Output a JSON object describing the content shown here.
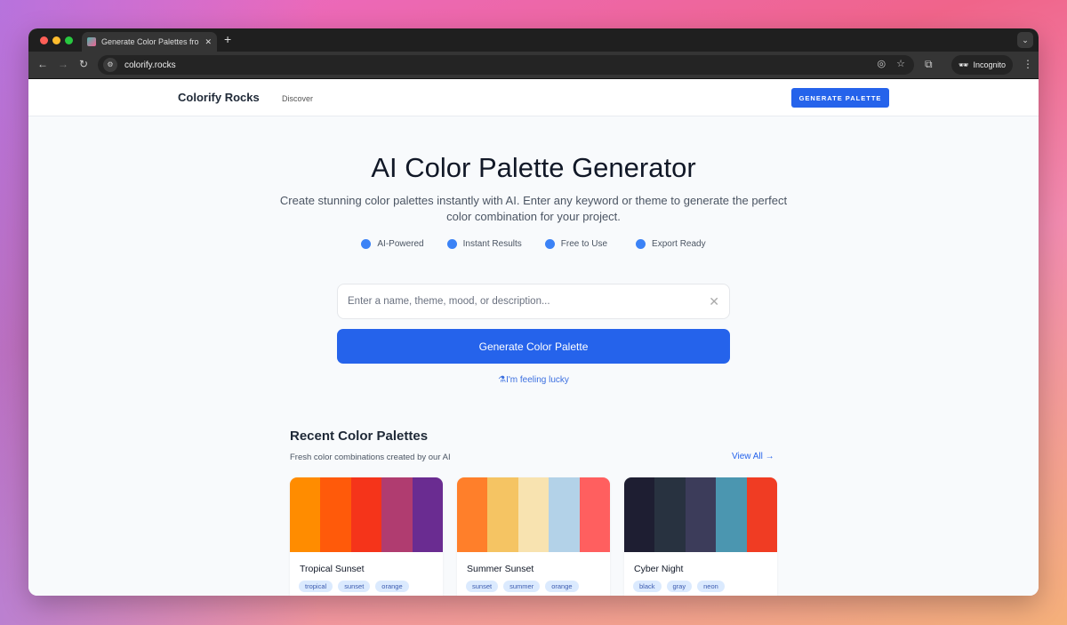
{
  "browser": {
    "tab_title": "Generate Color Palettes from",
    "url": "colorify.rocks",
    "incognito_label": "Incognito"
  },
  "header": {
    "logo": "Colorify Rocks",
    "nav": [
      "Discover"
    ],
    "cta": "GENERATE PALETTE"
  },
  "hero": {
    "title": "AI Color Palette Generator",
    "subtitle": "Create stunning color palettes instantly with AI. Enter any keyword or theme to generate the perfect color combination for your project.",
    "features": [
      "AI-Powered",
      "Instant Results",
      "Free to Use",
      "Export Ready"
    ],
    "feature_dot_color": "#3b82f6"
  },
  "search": {
    "placeholder": "Enter a name, theme, mood, or description...",
    "value": "",
    "button": "Generate Color Palette",
    "lucky": "I'm feeling lucky"
  },
  "recent": {
    "title": "Recent Color Palettes",
    "subtitle": "Fresh color combinations created by our AI",
    "view_all": "View All →",
    "palettes": [
      {
        "name": "Tropical Sunset",
        "colors": [
          "#ff8c00",
          "#ff5a0a",
          "#f5341a",
          "#b03c70",
          "#6a2c91"
        ],
        "tags": [
          "tropical",
          "sunset",
          "orange"
        ]
      },
      {
        "name": "Summer Sunset",
        "colors": [
          "#ff7f2a",
          "#f5c463",
          "#f8e3b0",
          "#b3d2e8",
          "#ff5f5f"
        ],
        "tags": [
          "sunset",
          "summer",
          "orange"
        ]
      },
      {
        "name": "Cyber Night",
        "colors": [
          "#1e1e32",
          "#283240",
          "#3c3c5a",
          "#4b96b0",
          "#f03c23"
        ],
        "tags": [
          "black",
          "gray",
          "neon"
        ]
      }
    ]
  },
  "accent": "#2563eb"
}
